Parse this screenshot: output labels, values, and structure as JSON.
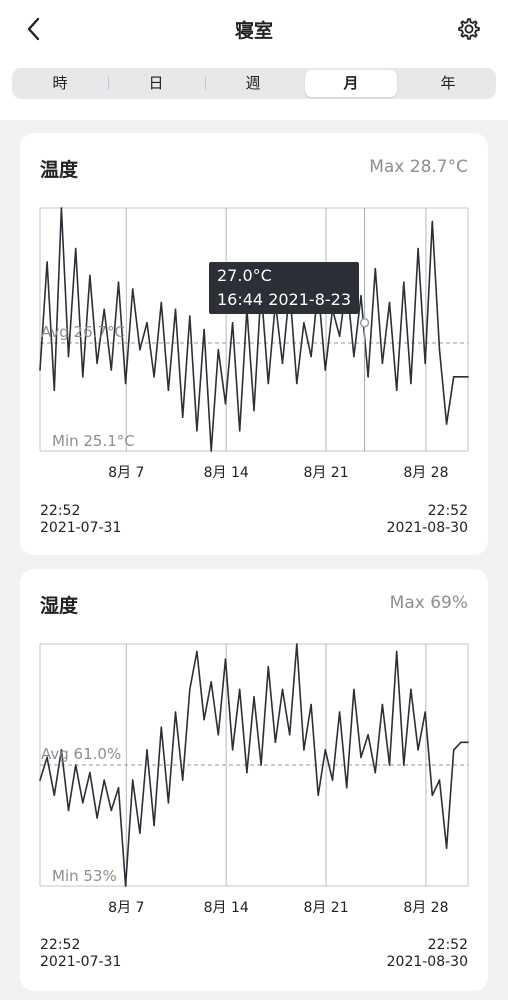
{
  "header": {
    "title": "寝室",
    "tabs": [
      "時",
      "日",
      "週",
      "月",
      "年"
    ],
    "active_tab": 3
  },
  "cards": [
    {
      "title": "温度",
      "max": "Max 28.7°C",
      "avg": "Avg 26.7°C",
      "min": "Min 25.1°C",
      "x_ticks": [
        "8月 7",
        "8月 14",
        "8月 21",
        "8月 28"
      ],
      "start_time": "22:52",
      "start_date": "2021-07-31",
      "end_time": "22:52",
      "end_date": "2021-08-30",
      "tooltip": {
        "value": "27.0°C",
        "time": "16:44 2021-8-23"
      }
    },
    {
      "title": "湿度",
      "max": "Max 69%",
      "avg": "Avg 61.0%",
      "min": "Min 53%",
      "x_ticks": [
        "8月 7",
        "8月 14",
        "8月 21",
        "8月 28"
      ],
      "start_time": "22:52",
      "start_date": "2021-07-31",
      "end_time": "22:52",
      "end_date": "2021-08-30"
    }
  ],
  "chart_data": [
    {
      "type": "line",
      "title": "温度",
      "xlabel": "",
      "ylabel": "",
      "xlim": [
        "2021-07-31 22:52",
        "2021-08-30 22:52"
      ],
      "ylim": [
        25.1,
        28.7
      ],
      "avg": 26.7,
      "x": [
        0.0,
        0.5,
        1.0,
        1.5,
        2.0,
        2.5,
        3.0,
        3.5,
        4.0,
        4.5,
        5.0,
        5.5,
        6.0,
        6.5,
        7.0,
        7.5,
        8.0,
        8.5,
        9.0,
        9.5,
        10.0,
        10.5,
        11.0,
        11.5,
        12.0,
        12.5,
        13.0,
        13.5,
        14.0,
        14.5,
        15.0,
        15.5,
        16.0,
        16.5,
        17.0,
        17.5,
        18.0,
        18.5,
        19.0,
        19.5,
        20.0,
        20.5,
        21.0,
        21.5,
        22.0,
        22.5,
        23.0,
        23.5,
        24.0,
        24.5,
        25.0,
        25.5,
        26.0,
        26.5,
        27.0,
        27.5,
        28.0,
        28.5,
        29.0,
        29.5,
        30.0
      ],
      "series": [
        {
          "values": [
            26.3,
            27.9,
            26.0,
            28.7,
            26.5,
            28.1,
            26.2,
            27.7,
            26.4,
            27.2,
            26.3,
            27.6,
            26.1,
            27.5,
            26.6,
            27.0,
            26.2,
            27.3,
            26.0,
            27.2,
            25.6,
            27.1,
            25.4,
            26.9,
            25.1,
            26.6,
            25.8,
            27.0,
            25.4,
            27.2,
            25.7,
            27.5,
            26.1,
            27.3,
            26.4,
            27.5,
            26.1,
            27.0,
            26.5,
            27.5,
            26.3,
            27.2,
            26.8,
            27.6,
            26.5,
            27.4,
            26.2,
            27.8,
            26.4,
            27.3,
            26.0,
            27.6,
            26.1,
            28.1,
            26.4,
            28.5,
            26.6,
            25.5,
            26.2,
            26.2,
            26.2
          ]
        }
      ],
      "highlight": {
        "x": 22.75,
        "y": 27.0
      }
    },
    {
      "type": "line",
      "title": "湿度",
      "xlabel": "",
      "ylabel": "",
      "xlim": [
        "2021-07-31 22:52",
        "2021-08-30 22:52"
      ],
      "ylim": [
        53,
        69
      ],
      "avg": 61.0,
      "x": [
        0.0,
        0.5,
        1.0,
        1.5,
        2.0,
        2.5,
        3.0,
        3.5,
        4.0,
        4.5,
        5.0,
        5.5,
        6.0,
        6.5,
        7.0,
        7.5,
        8.0,
        8.5,
        9.0,
        9.5,
        10.0,
        10.5,
        11.0,
        11.5,
        12.0,
        12.5,
        13.0,
        13.5,
        14.0,
        14.5,
        15.0,
        15.5,
        16.0,
        16.5,
        17.0,
        17.5,
        18.0,
        18.5,
        19.0,
        19.5,
        20.0,
        20.5,
        21.0,
        21.5,
        22.0,
        22.5,
        23.0,
        23.5,
        24.0,
        24.5,
        25.0,
        25.5,
        26.0,
        26.5,
        27.0,
        27.5,
        28.0,
        28.5,
        29.0,
        29.5,
        30.0
      ],
      "series": [
        {
          "values": [
            60.0,
            61.5,
            59.0,
            62.0,
            58.0,
            61.0,
            58.5,
            60.5,
            57.5,
            60.0,
            58.0,
            59.5,
            53.0,
            60.0,
            56.5,
            62.0,
            57.0,
            63.5,
            58.5,
            64.5,
            60.0,
            66.0,
            68.5,
            64.0,
            66.5,
            63.0,
            68.0,
            62.0,
            66.0,
            60.5,
            65.5,
            61.0,
            67.5,
            62.5,
            66.0,
            63.0,
            69.0,
            62.0,
            65.0,
            59.0,
            62.0,
            60.0,
            64.5,
            59.5,
            66.0,
            61.5,
            63.0,
            60.5,
            65.0,
            61.0,
            68.5,
            61.0,
            66.0,
            62.0,
            64.5,
            59.0,
            60.0,
            55.5,
            62.0,
            62.5,
            62.5
          ]
        }
      ]
    }
  ]
}
